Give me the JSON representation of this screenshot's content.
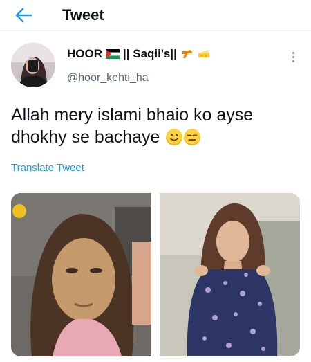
{
  "header": {
    "title": "Tweet",
    "back_icon": "arrow-left-icon",
    "accent": "#1d9bf0"
  },
  "author": {
    "display_name_prefix": "HOOR",
    "display_name_mid": "|| Saqii's||",
    "handle": "@hoor_kehti_ha",
    "emojis": [
      "palestine-flag-icon",
      "water-pistol-icon",
      "cheese-wedge-icon"
    ]
  },
  "tweet": {
    "text": "Allah mery islami bhaio ko ayse dhokhy se bachaye",
    "emojis": [
      "slightly-smiling-face-icon",
      "expressionless-face-icon"
    ],
    "translate_label": "Translate Tweet"
  },
  "media": {
    "count": 2,
    "items": [
      {
        "name": "photo-left",
        "description": "woman without makeup"
      },
      {
        "name": "photo-right",
        "description": "woman in floral dress"
      }
    ]
  },
  "menu": {
    "icon": "more-vertical-icon"
  }
}
